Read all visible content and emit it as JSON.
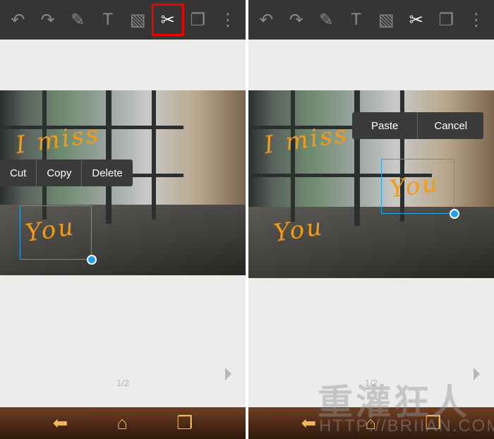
{
  "toolbar": {
    "icons": [
      "undo-icon",
      "redo-icon",
      "pen-icon",
      "text-icon",
      "image-icon",
      "scissors-icon",
      "pages-icon",
      "more-icon"
    ]
  },
  "left": {
    "handwriting": [
      "I miss",
      "You"
    ],
    "context_menu": [
      "Cut",
      "Copy",
      "Delete"
    ],
    "page_indicator": "1/2"
  },
  "right": {
    "handwriting": [
      "I miss",
      "You",
      "You"
    ],
    "context_menu": [
      "Paste",
      "Cancel"
    ]
  },
  "navbar": {
    "icons": [
      "back-icon",
      "home-icon",
      "recent-apps-icon"
    ]
  },
  "watermark": {
    "title": "重灌狂人",
    "url": "HTTP://BRIIAN.COM"
  },
  "colors": {
    "highlight": "#e00000",
    "handwriting": "#f59a12",
    "selection": "#1fa0ef",
    "toolbar": "#353535"
  }
}
